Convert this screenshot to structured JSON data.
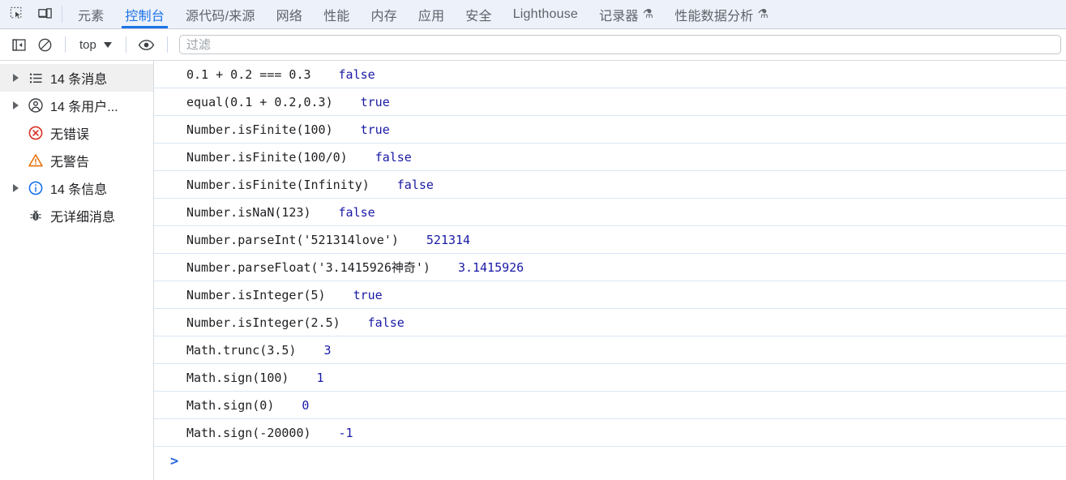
{
  "tabbar": {
    "left_icons": [
      {
        "name": "inspect-element-icon",
        "label": "inspect-element"
      },
      {
        "name": "device-toolbar-icon",
        "label": "device-toolbar"
      }
    ],
    "tabs": [
      {
        "label": "元素",
        "active": false,
        "flask": ""
      },
      {
        "label": "控制台",
        "active": true,
        "flask": ""
      },
      {
        "label": "源代码/来源",
        "active": false,
        "flask": ""
      },
      {
        "label": "网络",
        "active": false,
        "flask": ""
      },
      {
        "label": "性能",
        "active": false,
        "flask": ""
      },
      {
        "label": "内存",
        "active": false,
        "flask": ""
      },
      {
        "label": "应用",
        "active": false,
        "flask": ""
      },
      {
        "label": "安全",
        "active": false,
        "flask": ""
      },
      {
        "label": "Lighthouse",
        "active": false,
        "flask": ""
      },
      {
        "label": "记录器",
        "active": false,
        "flask": "⚗"
      },
      {
        "label": "性能数据分析",
        "active": false,
        "flask": "⚗"
      }
    ],
    "active_color": "#1a73e8",
    "background": "#edf1fa"
  },
  "toolbar": {
    "sidebar_toggle_name": "show-console-sidebar-icon",
    "clear_console_name": "clear-console-icon",
    "context_selector": "top",
    "eye_icon_name": "live-expression-icon",
    "filter": {
      "value": "",
      "placeholder": "过滤"
    }
  },
  "sidebar": {
    "items": [
      {
        "label": "14 条消息",
        "icon": "list-icon",
        "expandable": true,
        "selected": true
      },
      {
        "label": "14 条用户...",
        "icon": "user-message-icon",
        "expandable": true,
        "selected": false
      },
      {
        "label": "无错误",
        "icon": "error-icon",
        "expandable": false,
        "selected": false
      },
      {
        "label": "无警告",
        "icon": "warning-icon",
        "expandable": false,
        "selected": false
      },
      {
        "label": "14 条信息",
        "icon": "info-icon",
        "expandable": true,
        "selected": false
      },
      {
        "label": "无详细消息",
        "icon": "verbose-bug-icon",
        "expandable": false,
        "selected": false
      }
    ]
  },
  "console": {
    "messages": [
      {
        "label": "0.1 + 0.2 === 0.3",
        "value": "false",
        "gap": "gap-2"
      },
      {
        "label": "equal(0.1 + 0.2,0.3)",
        "value": "true",
        "gap": "gap-2"
      },
      {
        "label": "Number.isFinite(100)",
        "value": "true",
        "gap": "gap-2"
      },
      {
        "label": "Number.isFinite(100/0)",
        "value": "false",
        "gap": "gap-2"
      },
      {
        "label": "Number.isFinite(Infinity)",
        "value": "false",
        "gap": "gap-2"
      },
      {
        "label": "Number.isNaN(123)",
        "value": "false",
        "gap": "gap-2"
      },
      {
        "label": "Number.parseInt('521314love')",
        "value": "521314",
        "gap": "gap-2"
      },
      {
        "label": "Number.parseFloat('3.1415926神奇')",
        "value": "3.1415926",
        "gap": "gap-2"
      },
      {
        "label": "Number.isInteger(5)",
        "value": "true",
        "gap": "gap-2"
      },
      {
        "label": "Number.isInteger(2.5)",
        "value": "false",
        "gap": "gap-2"
      },
      {
        "label": "Math.trunc(3.5)",
        "value": "3",
        "gap": "gap-2"
      },
      {
        "label": "Math.sign(100)",
        "value": "1",
        "gap": "gap-2"
      },
      {
        "label": "Math.sign(0)",
        "value": "0",
        "gap": "gap-2"
      },
      {
        "label": "Math.sign(-20000)",
        "value": "-1",
        "gap": "gap-2"
      }
    ],
    "prompt": ">",
    "value_color": "#1a1aa6",
    "label_color": "#202124",
    "row_divider_color": "#d9e6f5"
  }
}
